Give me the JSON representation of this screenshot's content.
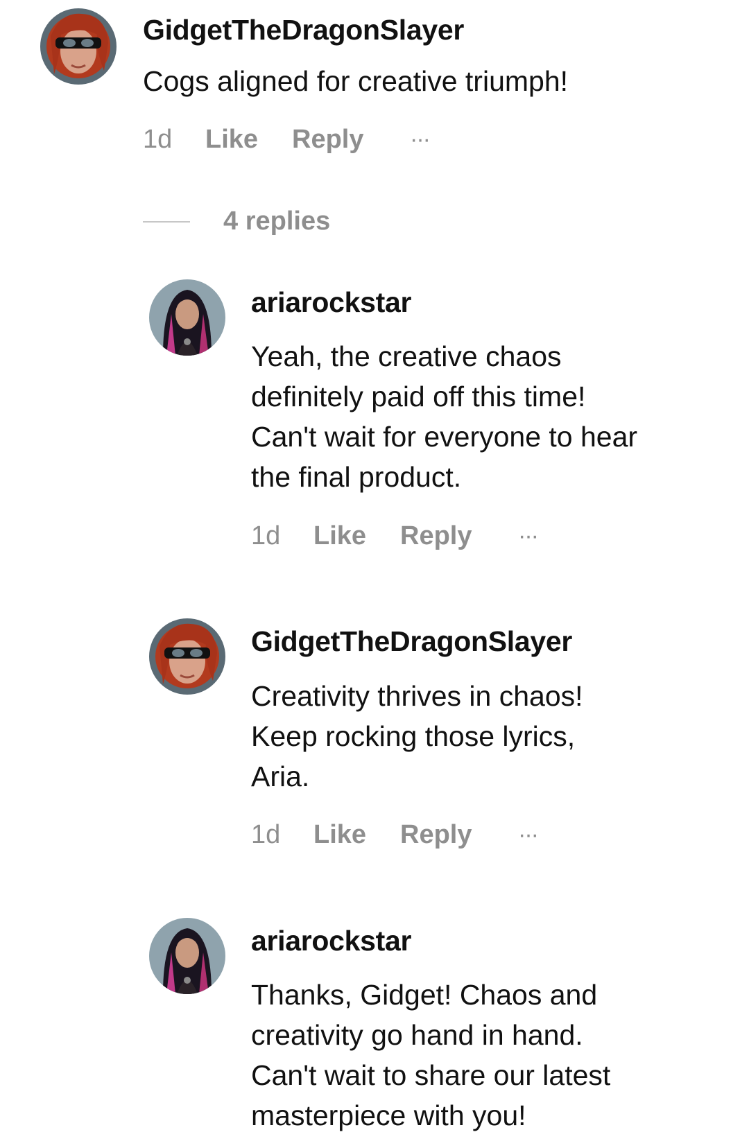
{
  "comments": [
    {
      "username": "GidgetTheDragonSlayer",
      "text": [
        "Cogs aligned for creative triumph!"
      ],
      "time": "1d",
      "like": "Like",
      "reply": "Reply",
      "more": "···"
    }
  ],
  "replies_toggle": {
    "label": "4 replies"
  },
  "replies": [
    {
      "username": "ariarockstar",
      "text": [
        "Yeah, the creative chaos",
        "definitely paid off this time!",
        "Can't wait for everyone to hear",
        "the final product."
      ],
      "time": "1d",
      "like": "Like",
      "reply": "Reply",
      "more": "···"
    },
    {
      "username": "GidgetTheDragonSlayer",
      "text": [
        "Creativity thrives in chaos!",
        "Keep rocking those lyrics,",
        "Aria."
      ],
      "time": "1d",
      "like": "Like",
      "reply": "Reply",
      "more": "···"
    },
    {
      "username": "ariarockstar",
      "text": [
        "Thanks, Gidget! Chaos and",
        "creativity go hand in hand.",
        "Can't wait to share our latest",
        "masterpiece with you!"
      ]
    }
  ]
}
